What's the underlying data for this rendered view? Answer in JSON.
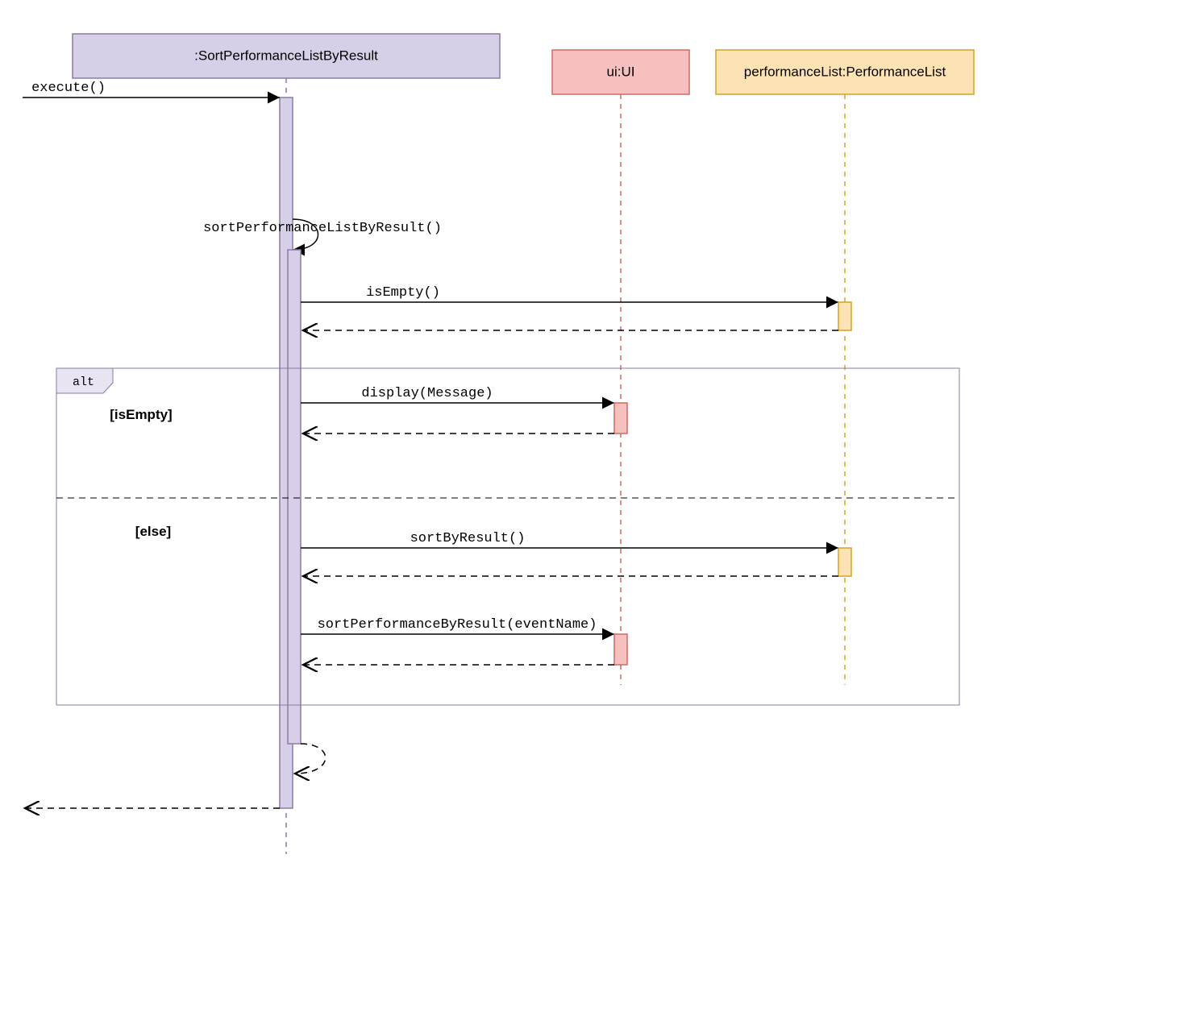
{
  "participants": {
    "sort": ":SortPerformanceListByResult",
    "ui": "ui:UI",
    "perf": "performanceList:PerformanceList"
  },
  "messages": {
    "execute": "execute()",
    "selfcall": "sortPerformanceListByResult()",
    "isEmpty": "isEmpty()",
    "display": "display(Message)",
    "sortByResult": "sortByResult()",
    "sortPerfByResult": "sortPerformanceByResult(eventName)"
  },
  "fragment": {
    "label": "alt",
    "guard_if": "[isEmpty]",
    "guard_else": "[else]"
  },
  "colors": {
    "sort_fill": "#d7cfe8",
    "sort_stroke": "#8a7aa5",
    "ui_fill": "#f5c0bd",
    "ui_stroke": "#d16a63",
    "perf_fill": "#fde2b3",
    "perf_stroke": "#d4a229",
    "alt_header_fill": "#e9e4f2"
  }
}
